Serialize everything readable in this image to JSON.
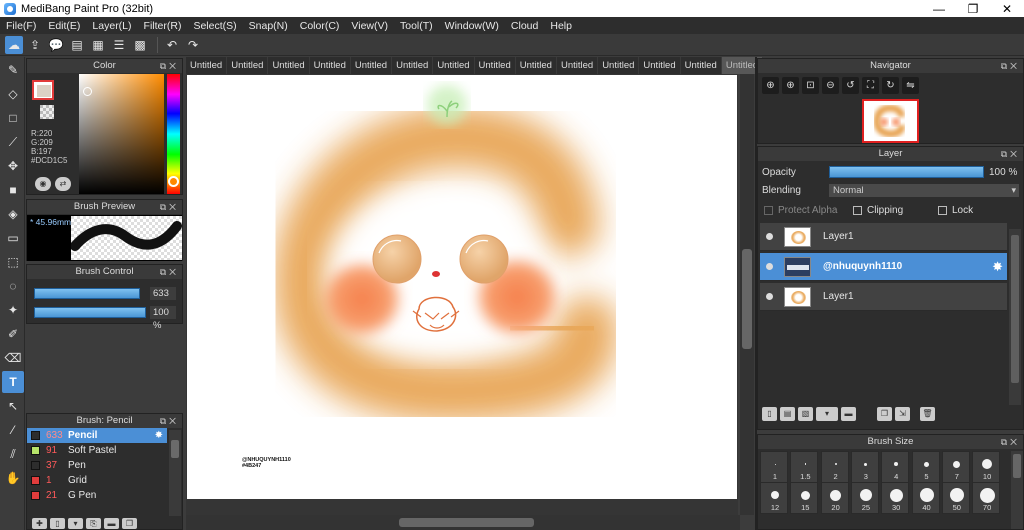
{
  "window": {
    "title": "MediBang Paint Pro (32bit)",
    "minimize": "—",
    "maximize": "❐",
    "close": "✕"
  },
  "menu": [
    "File(F)",
    "Edit(E)",
    "Layer(L)",
    "Filter(R)",
    "Select(S)",
    "Snap(N)",
    "Color(C)",
    "View(V)",
    "Tool(T)",
    "Window(W)",
    "Cloud",
    "Help"
  ],
  "toolbar_icons": [
    "cloud-icon",
    "share-icon",
    "comment-icon",
    "panel-icon",
    "document-icon",
    "list-icon",
    "grid-icon",
    "undo-icon",
    "redo-icon"
  ],
  "left_tools": [
    "brush-tool-icon",
    "eraser-tool-icon",
    "rectangle-tool-icon",
    "pen-line-icon",
    "move-tool-icon",
    "fill-rect-icon",
    "bucket-fill-icon",
    "gradient-icon",
    "select-rect-icon",
    "lasso-icon",
    "magic-wand-icon",
    "select-pen-icon",
    "select-eraser-icon",
    "text-tool-icon",
    "operation-icon",
    "eyedropper-icon",
    "dropper-icon",
    "hand-tool-icon"
  ],
  "color_panel": {
    "title": "Color",
    "r": "R:220",
    "g": "G:209",
    "b": "B:197",
    "hex": "#DCD1C5",
    "current_color": "#DCD1C5"
  },
  "brush_preview": {
    "title": "Brush Preview",
    "size": "* 45.96mm"
  },
  "brush_control": {
    "title": "Brush Control",
    "size_value": "633",
    "opacity_value": "100 %",
    "size_fraction": 0.95,
    "opacity_fraction": 1.0
  },
  "brush_list": {
    "title": "Brush: Pencil",
    "items": [
      {
        "num": "633",
        "name": "Pencil",
        "color": "#2d2d2d",
        "selected": true
      },
      {
        "num": "91",
        "name": "Soft Pastel",
        "color": "#b6e36a",
        "selected": false
      },
      {
        "num": "37",
        "name": "Pen",
        "color": "#2d2d2d",
        "selected": false
      },
      {
        "num": "1",
        "name": "Grid",
        "color": "#e03c3c",
        "selected": false
      },
      {
        "num": "21",
        "name": "G Pen",
        "color": "#e03c3c",
        "selected": false
      }
    ]
  },
  "tabs": [
    "Untitled",
    "Untitled",
    "Untitled",
    "Untitled",
    "Untitled",
    "Untitled",
    "Untitled",
    "Untitled",
    "Untitled",
    "Untitled",
    "Untitled",
    "Untitled",
    "Untitled",
    "Untitled"
  ],
  "artwork": {
    "signature_line1": "@NHUQUYNH1110",
    "signature_line2": "#4B247"
  },
  "navigator": {
    "title": "Navigator"
  },
  "layer_panel": {
    "title": "Layer",
    "opacity_label": "Opacity",
    "opacity_value": "100 %",
    "blending_label": "Blending",
    "blending_value": "Normal",
    "protect_alpha": "Protect Alpha",
    "clipping": "Clipping",
    "lock": "Lock",
    "layers": [
      {
        "name": "Layer1",
        "selected": false,
        "watermark": false
      },
      {
        "name": "@nhuquynh1110",
        "selected": true,
        "watermark": true
      },
      {
        "name": "Layer1",
        "selected": false,
        "watermark": false
      }
    ]
  },
  "brush_size": {
    "title": "Brush Size",
    "sizes": [
      "1",
      "1.5",
      "2",
      "3",
      "4",
      "5",
      "7",
      "10",
      "12",
      "15",
      "20",
      "25",
      "30",
      "40",
      "50",
      "70"
    ]
  },
  "colors": {
    "accent": "#4b8fd6",
    "panel_bg": "#2d2d2d",
    "art_orange": "#e8a657",
    "art_blush": "#f57f4b"
  }
}
